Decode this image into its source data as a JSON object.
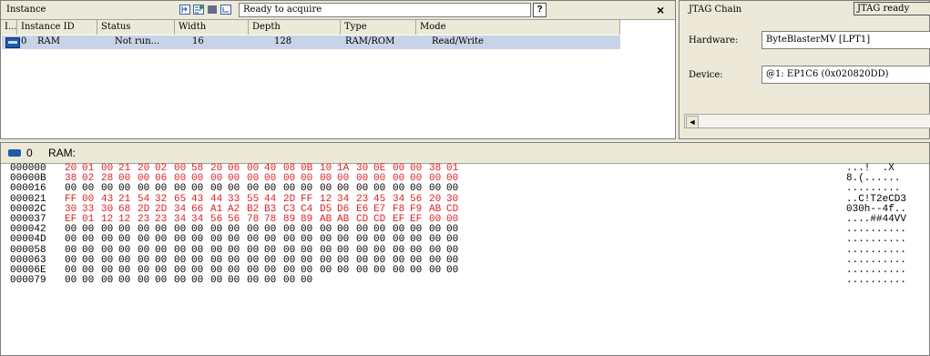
{
  "instance_panel": {
    "title": "Instance",
    "status": "Ready to acquire",
    "help_label": "?",
    "close_label": "×",
    "columns": [
      "I...",
      "Instance ID",
      "Status",
      "Width",
      "Depth",
      "Type",
      "Mode"
    ],
    "row": {
      "index": "0",
      "instance_id": "RAM",
      "status": "Not run...",
      "width": "16",
      "depth": "128",
      "type": "RAM/ROM",
      "mode": "Read/Write"
    }
  },
  "jtag": {
    "title": "JTAG Chain",
    "status": "JTAG ready",
    "hardware_label": "Hardware:",
    "hardware_value": "ByteBlasterMV [LPT1]",
    "device_label": "Device:",
    "device_value": "@1: EP1C6 (0x020820DD)",
    "scroll_left": "◄"
  },
  "memory": {
    "instance_index": "0",
    "instance_name": "RAM:",
    "rows": [
      {
        "addr": "000000",
        "bytes": [
          "20",
          "01",
          "00",
          "21",
          "20",
          "02",
          "00",
          "58",
          "20",
          "06",
          "00",
          "40",
          "08",
          "0B",
          "10",
          "1A",
          "30",
          "0E",
          "00",
          "00",
          "38",
          "01"
        ],
        "ascii": "...!  .X"
      },
      {
        "addr": "00000B",
        "bytes": [
          "38",
          "02",
          "28",
          "00",
          "00",
          "06",
          "00",
          "00",
          "00",
          "00",
          "00",
          "00",
          "00",
          "00",
          "00",
          "00",
          "00",
          "00",
          "00",
          "00",
          "00",
          "00"
        ],
        "ascii": "8.(......"
      },
      {
        "addr": "000016",
        "bytes": [
          "00",
          "00",
          "00",
          "00",
          "00",
          "00",
          "00",
          "00",
          "00",
          "00",
          "00",
          "00",
          "00",
          "00",
          "00",
          "00",
          "00",
          "00",
          "00",
          "00",
          "00",
          "00"
        ],
        "ascii": "........."
      },
      {
        "addr": "000021",
        "bytes": [
          "FF",
          "00",
          "43",
          "21",
          "54",
          "32",
          "65",
          "43",
          "44",
          "33",
          "55",
          "44",
          "2D",
          "FF",
          "12",
          "34",
          "23",
          "45",
          "34",
          "56",
          "20",
          "30"
        ],
        "ascii": "..C!T2eCD3"
      },
      {
        "addr": "00002C",
        "bytes": [
          "30",
          "33",
          "30",
          "68",
          "2D",
          "2D",
          "34",
          "66",
          "A1",
          "A2",
          "B2",
          "B3",
          "C3",
          "C4",
          "D5",
          "D6",
          "E6",
          "E7",
          "F8",
          "F9",
          "AB",
          "CD"
        ],
        "ascii": "030h--4f.."
      },
      {
        "addr": "000037",
        "bytes": [
          "EF",
          "01",
          "12",
          "12",
          "23",
          "23",
          "34",
          "34",
          "56",
          "56",
          "78",
          "78",
          "89",
          "89",
          "AB",
          "AB",
          "CD",
          "CD",
          "EF",
          "EF",
          "00",
          "00"
        ],
        "ascii": "....##44VV"
      },
      {
        "addr": "000042",
        "bytes": [
          "00",
          "00",
          "00",
          "00",
          "00",
          "00",
          "00",
          "00",
          "00",
          "00",
          "00",
          "00",
          "00",
          "00",
          "00",
          "00",
          "00",
          "00",
          "00",
          "00",
          "00",
          "00"
        ],
        "ascii": ".........."
      },
      {
        "addr": "00004D",
        "bytes": [
          "00",
          "00",
          "00",
          "00",
          "00",
          "00",
          "00",
          "00",
          "00",
          "00",
          "00",
          "00",
          "00",
          "00",
          "00",
          "00",
          "00",
          "00",
          "00",
          "00",
          "00",
          "00"
        ],
        "ascii": ".........."
      },
      {
        "addr": "000058",
        "bytes": [
          "00",
          "00",
          "00",
          "00",
          "00",
          "00",
          "00",
          "00",
          "00",
          "00",
          "00",
          "00",
          "00",
          "00",
          "00",
          "00",
          "00",
          "00",
          "00",
          "00",
          "00",
          "00"
        ],
        "ascii": ".........."
      },
      {
        "addr": "000063",
        "bytes": [
          "00",
          "00",
          "00",
          "00",
          "00",
          "00",
          "00",
          "00",
          "00",
          "00",
          "00",
          "00",
          "00",
          "00",
          "00",
          "00",
          "00",
          "00",
          "00",
          "00",
          "00",
          "00"
        ],
        "ascii": ".........."
      },
      {
        "addr": "00006E",
        "bytes": [
          "00",
          "00",
          "00",
          "00",
          "00",
          "00",
          "00",
          "00",
          "00",
          "00",
          "00",
          "00",
          "00",
          "00",
          "00",
          "00",
          "00",
          "00",
          "00",
          "00",
          "00",
          "00"
        ],
        "ascii": ".........."
      },
      {
        "addr": "000079",
        "bytes": [
          "00",
          "00",
          "00",
          "00",
          "00",
          "00",
          "00",
          "00",
          "00",
          "00",
          "00",
          "00",
          "00",
          "00"
        ],
        "ascii": ".........."
      }
    ],
    "highlight_rows": [
      0,
      1,
      3,
      4,
      5
    ],
    "highlight_color": "#e02020"
  }
}
